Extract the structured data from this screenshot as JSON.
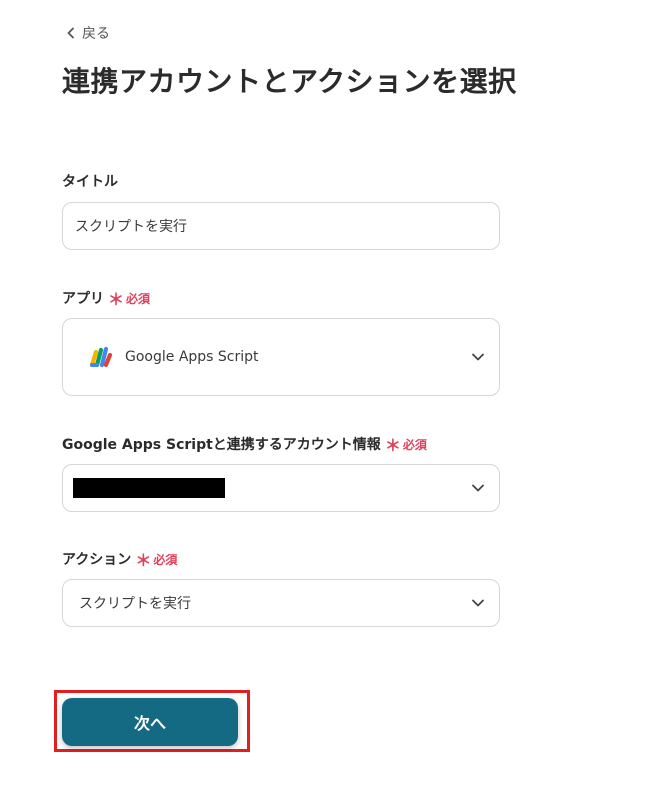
{
  "header": {
    "back_label": "戻る",
    "title": "連携アカウントとアクションを選択"
  },
  "required": {
    "star": "＊",
    "text": "必須"
  },
  "fields": {
    "title": {
      "label": "タイトル",
      "value": "スクリプトを実行"
    },
    "app": {
      "label": "アプリ",
      "value": "Google Apps Script",
      "icon": "google-apps-script-icon"
    },
    "account": {
      "label": "Google Apps Scriptと連携するアカウント情報",
      "value_redacted": true
    },
    "action": {
      "label": "アクション",
      "value": "スクリプトを実行"
    }
  },
  "footer": {
    "next_label": "次へ"
  },
  "colors": {
    "primary_button": "#136a82",
    "required": "#e0415a",
    "highlight": "#e02020",
    "border": "#d6d6d6"
  }
}
